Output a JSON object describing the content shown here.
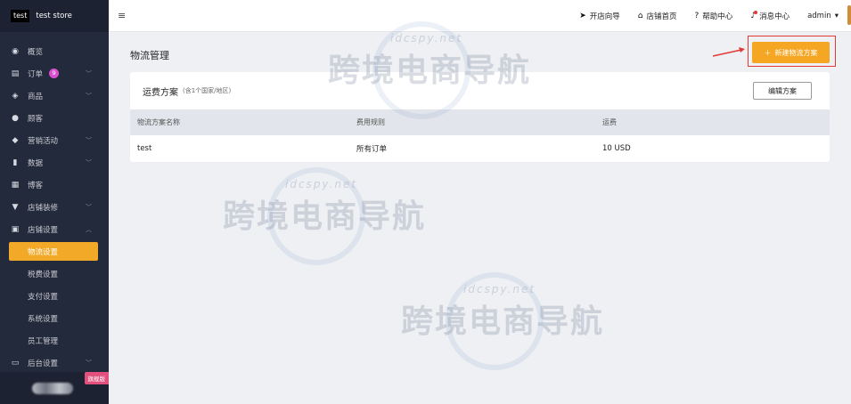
{
  "brand": {
    "logo": "test",
    "store_name": "test store"
  },
  "sidebar": {
    "items": [
      {
        "label": "概览",
        "icon": "dashboard-icon",
        "glyph": "◉",
        "chevron": false
      },
      {
        "label": "订单",
        "icon": "orders-icon",
        "glyph": "▤",
        "chevron": true,
        "badge": "9"
      },
      {
        "label": "商品",
        "icon": "products-icon",
        "glyph": "◈",
        "chevron": true
      },
      {
        "label": "顾客",
        "icon": "customers-icon",
        "glyph": "●",
        "chevron": false
      },
      {
        "label": "营销活动",
        "icon": "marketing-icon",
        "glyph": "◆",
        "chevron": true
      },
      {
        "label": "数据",
        "icon": "data-icon",
        "glyph": "▮",
        "chevron": true
      },
      {
        "label": "博客",
        "icon": "blog-icon",
        "glyph": "▦",
        "chevron": false
      },
      {
        "label": "店铺装修",
        "icon": "decor-icon",
        "glyph": "▼",
        "chevron": true
      },
      {
        "label": "店铺设置",
        "icon": "settings-icon",
        "glyph": "▣",
        "chevron": true,
        "expanded": true
      }
    ],
    "sub_items": [
      "物流设置",
      "税费设置",
      "支付设置",
      "系统设置",
      "员工管理"
    ],
    "active_sub": "物流设置",
    "backend_label": "后台设置",
    "flagship_label": "旗舰版"
  },
  "topbar": {
    "links": [
      {
        "label": "开店向导",
        "icon": "send-icon",
        "glyph": "➤"
      },
      {
        "label": "店铺首页",
        "icon": "home-icon",
        "glyph": "⌂"
      },
      {
        "label": "帮助中心",
        "icon": "help-icon",
        "glyph": "?"
      },
      {
        "label": "消息中心",
        "icon": "bell-icon",
        "glyph": "♪"
      }
    ],
    "user": "admin"
  },
  "main": {
    "page_title": "物流管理",
    "new_button": "新建物流方案",
    "card": {
      "title": "运费方案",
      "subtitle": "(含1个国家/地区)",
      "edit_button": "编辑方案",
      "columns": [
        "物流方案名称",
        "费用规则",
        "运费"
      ],
      "rows": [
        [
          "test",
          "所有订单",
          "10 USD"
        ]
      ]
    }
  },
  "watermark": {
    "cn": "跨境电商导航",
    "en": "idcspy.net"
  },
  "colors": {
    "accent": "#f5a623",
    "sidebar": "#232a3b",
    "badge": "#d94fd0",
    "highlight": "#e53935"
  }
}
